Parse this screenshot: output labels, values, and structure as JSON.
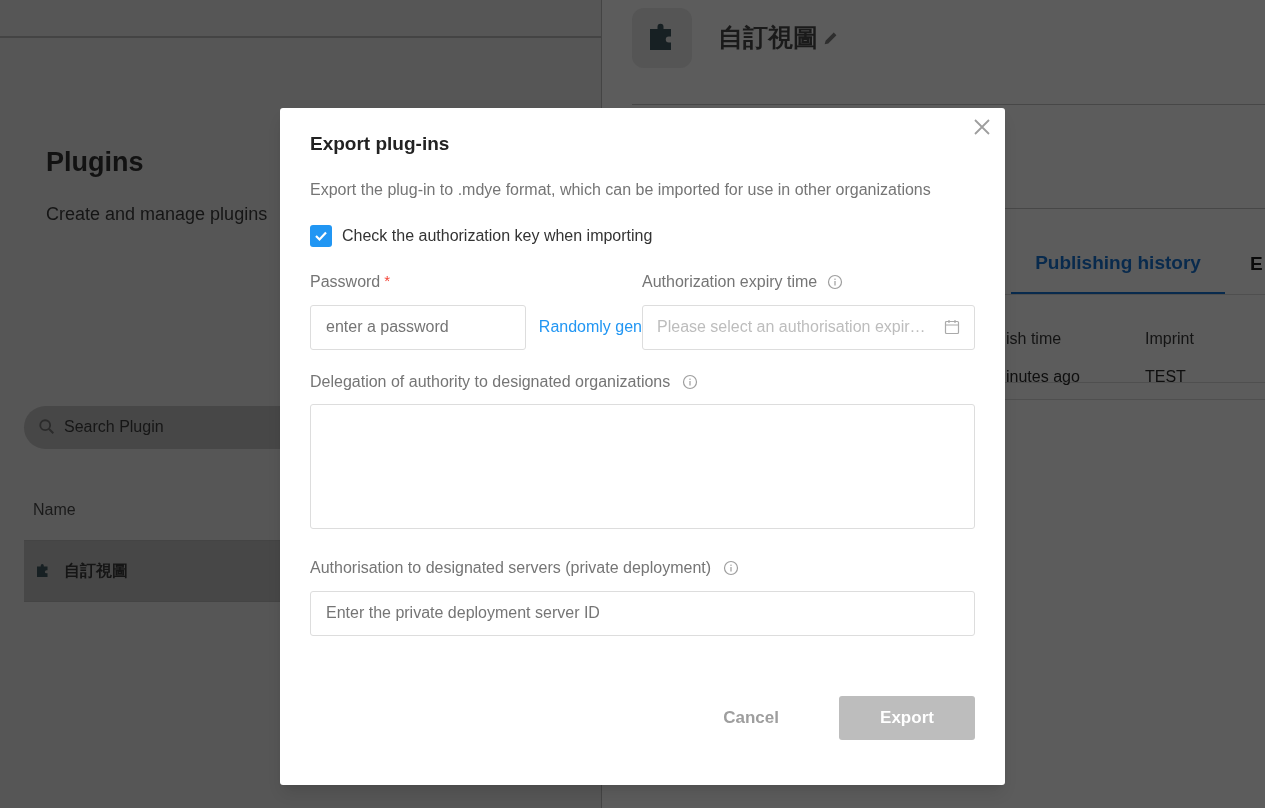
{
  "page": {
    "title": "Plugins",
    "subtitle": "Create and manage plugins",
    "search": {
      "placeholder": "Search Plugin"
    },
    "table": {
      "columns": [
        "Name"
      ],
      "rows": [
        {
          "name": "自訂視圖"
        }
      ]
    }
  },
  "detail": {
    "title": "自訂視圖",
    "tabs": [
      {
        "label": "Publishing history",
        "selected": true
      },
      {
        "label": "E",
        "selected": false
      }
    ],
    "table": {
      "columns": [
        "ish time",
        "Imprint"
      ],
      "rows": [
        [
          "inutes ago",
          "TEST"
        ]
      ]
    }
  },
  "dialog": {
    "title": "Export plug-ins",
    "description": "Export the plug-in to .mdye format, which can be imported for use in other organizations",
    "check_key": {
      "label": "Check the authorization key when importing",
      "checked": true
    },
    "password": {
      "label": "Password",
      "required_mark": "*",
      "placeholder": "enter a password",
      "link": "Randomly gen"
    },
    "expiry": {
      "label": "Authorization expiry time",
      "placeholder": "Please select an authorisation expir…"
    },
    "delegation": {
      "label": "Delegation of authority to designated organizations"
    },
    "servers": {
      "label": "Authorisation to designated servers (private deployment)",
      "placeholder": "Enter the private deployment server ID"
    },
    "buttons": [
      {
        "label": "Cancel",
        "kind": "text"
      },
      {
        "label": "Export",
        "kind": "primary",
        "disabled": true
      }
    ]
  }
}
